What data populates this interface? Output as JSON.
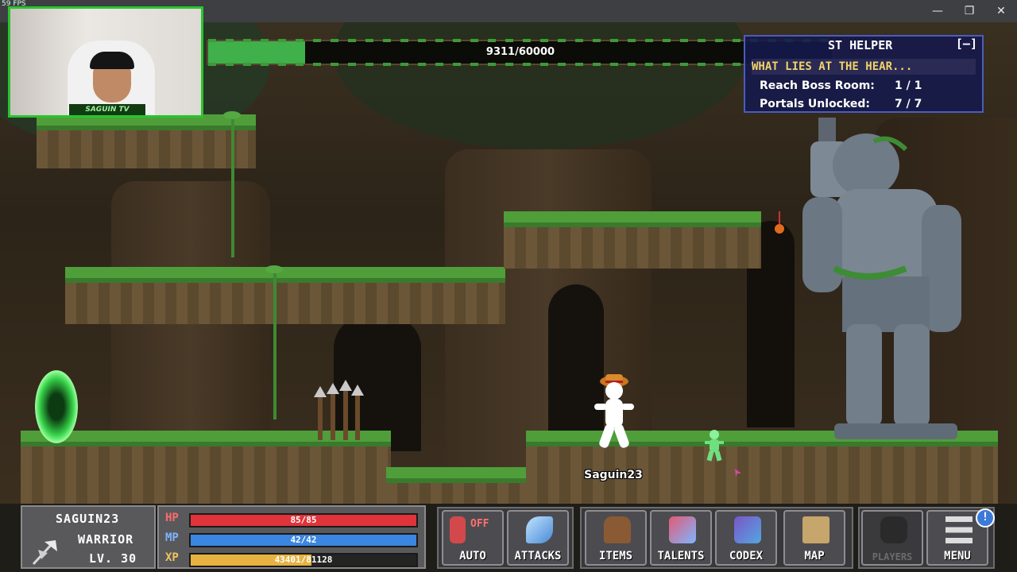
{
  "window": {
    "fps": "59 FPS",
    "minimize": "—",
    "restore": "❐",
    "close": "✕"
  },
  "webcam": {
    "label": "SAGUIN TV"
  },
  "progress": {
    "text": "9311/60000",
    "current": 9311,
    "max": 60000
  },
  "quest_helper": {
    "title": "ST HELPER",
    "toggle": "[–]",
    "quest_name": "WHAT LIES AT THE HEAR...",
    "rows": [
      {
        "label": "Reach Boss Room:",
        "value": "1 / 1"
      },
      {
        "label": "Portals Unlocked:",
        "value": "7 / 7"
      }
    ]
  },
  "player": {
    "name": "Saguin23"
  },
  "character": {
    "name": "SAGUIN23",
    "class": "WARRIOR",
    "level": "LV. 30"
  },
  "stats": {
    "hp": {
      "label": "HP",
      "text": "85/85",
      "fraction": 1.0,
      "color": "#e0343a"
    },
    "mp": {
      "label": "MP",
      "text": "42/42",
      "fraction": 1.0,
      "color": "#3a86e0"
    },
    "xp": {
      "label": "XP",
      "text": "43401/81128",
      "fraction": 0.535,
      "color": "#e6b340"
    }
  },
  "buttons": {
    "auto": {
      "label": "AUTO",
      "status": "OFF"
    },
    "attacks": {
      "label": "ATTACKS"
    },
    "items": {
      "label": "ITEMS"
    },
    "talents": {
      "label": "TALENTS"
    },
    "codex": {
      "label": "CODEX"
    },
    "map": {
      "label": "MAP"
    },
    "players": {
      "label": "PLAYERS"
    },
    "menu": {
      "label": "MENU"
    }
  },
  "notification_badge": "!"
}
